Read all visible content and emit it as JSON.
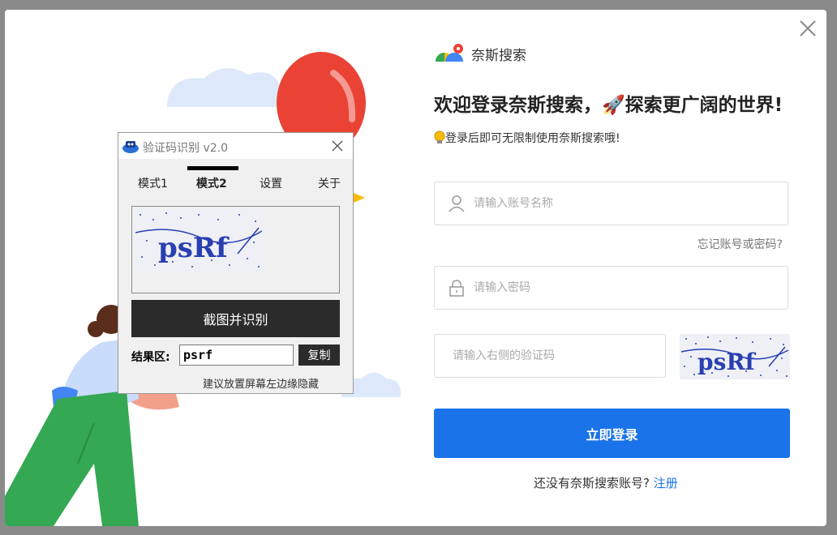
{
  "login": {
    "brand_name": "奈斯搜索",
    "headline": "欢迎登录奈斯搜索，🚀探索更广阔的世界!",
    "subline": "登录后即可无限制使用奈斯搜索哦!",
    "username_placeholder": "请输入账号名称",
    "forgot_label": "忘记账号或密码?",
    "password_placeholder": "请输入密码",
    "captcha_placeholder": "请输入右侧的验证码",
    "captcha_text": "psRf",
    "login_label": "立即登录",
    "register_prompt": "还没有奈斯搜索账号?",
    "register_link": "注册"
  },
  "tool": {
    "title": "验证码识别 v2.0",
    "tabs": [
      "模式1",
      "模式2",
      "设置",
      "关于"
    ],
    "active_tab": 1,
    "preview_captcha_text": "psRf",
    "capture_label": "截图并识别",
    "result_label": "结果区:",
    "result_value": "psrf",
    "copy_label": "复制",
    "hint": "建议放置屏幕左边缘隐藏"
  },
  "colors": {
    "primary": "#1a73e8",
    "balloon": "#ea4335",
    "pants": "#34a853",
    "tool_dark": "#2b2b2b",
    "captcha_ink": "#2a3fb0"
  },
  "icons": {
    "close": "close-icon",
    "logo": "nice-search-logo-icon",
    "tip": "lightbulb-icon",
    "user": "user-icon",
    "lock": "lock-icon",
    "tool_app": "tool-app-icon"
  }
}
